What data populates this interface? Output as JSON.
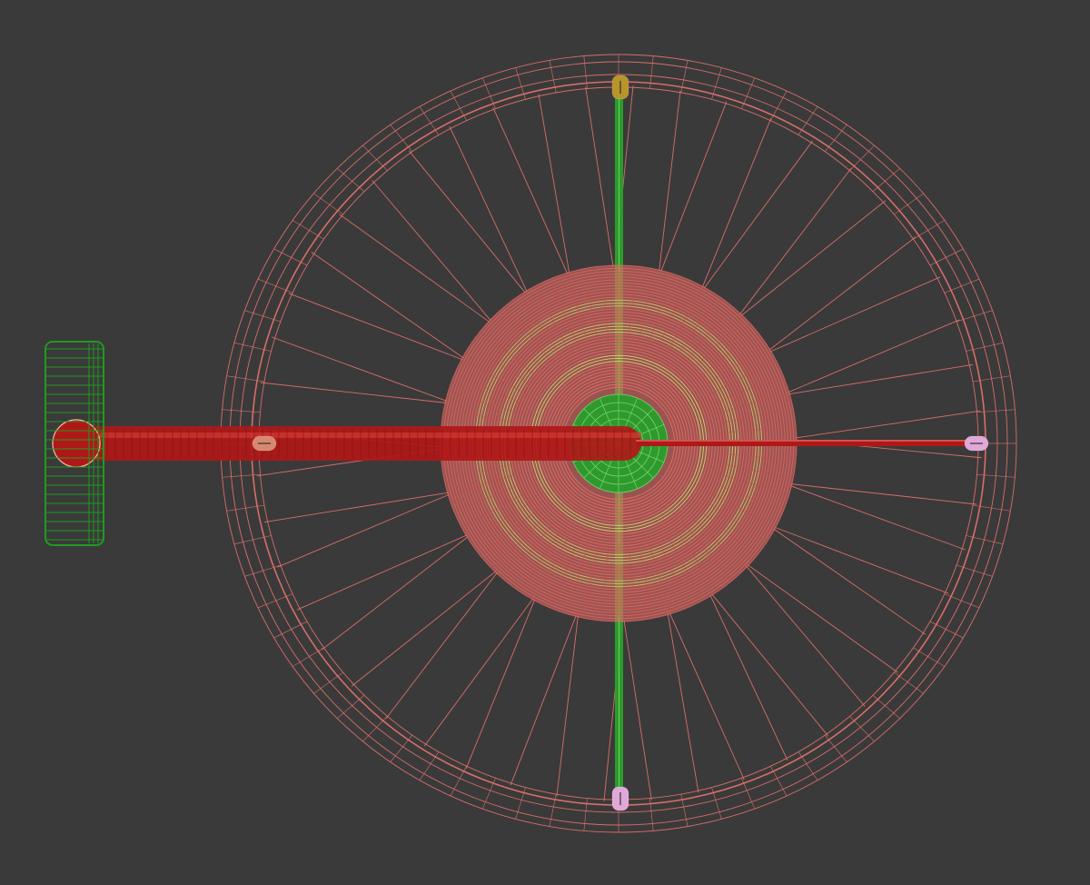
{
  "viewport": {
    "kind": "wireframe-viewport",
    "background": "#3a3a3a"
  },
  "colors": {
    "wire_salmon": "#e8746e",
    "wire_pink": "#f0908a",
    "hub_red": "#e86a64",
    "hub_yellow": "#d8d070",
    "hub_green": "#2e9a2e",
    "axle_red": "#b01818",
    "spoke_green": "#2aa02a",
    "handle_green": "#1f9a1f",
    "marker_gold": "#b8942a",
    "marker_pink": "#e0a8d8",
    "marker_salmon": "#d88870"
  },
  "objects": [
    {
      "name": "outer-wheel-ring",
      "type": "wireframe-torus"
    },
    {
      "name": "wheel-spokes",
      "type": "wireframe-lines",
      "count": 48
    },
    {
      "name": "hub",
      "type": "wireframe-cylinder"
    },
    {
      "name": "horizontal-axle",
      "type": "wireframe-rod"
    },
    {
      "name": "vertical-spoke-rod",
      "type": "wireframe-rod"
    },
    {
      "name": "side-grip",
      "type": "wireframe-box"
    }
  ],
  "markers": [
    {
      "name": "top-pivot-marker",
      "icon": "pivot-gizmo-icon",
      "color": "#b8942a"
    },
    {
      "name": "bottom-pivot-marker",
      "icon": "pivot-gizmo-icon",
      "color": "#e0a8d8"
    },
    {
      "name": "right-pivot-marker",
      "icon": "pivot-gizmo-icon",
      "color": "#e0a8d8"
    },
    {
      "name": "axle-pivot-marker",
      "icon": "pivot-gizmo-icon",
      "color": "#d88870"
    }
  ]
}
